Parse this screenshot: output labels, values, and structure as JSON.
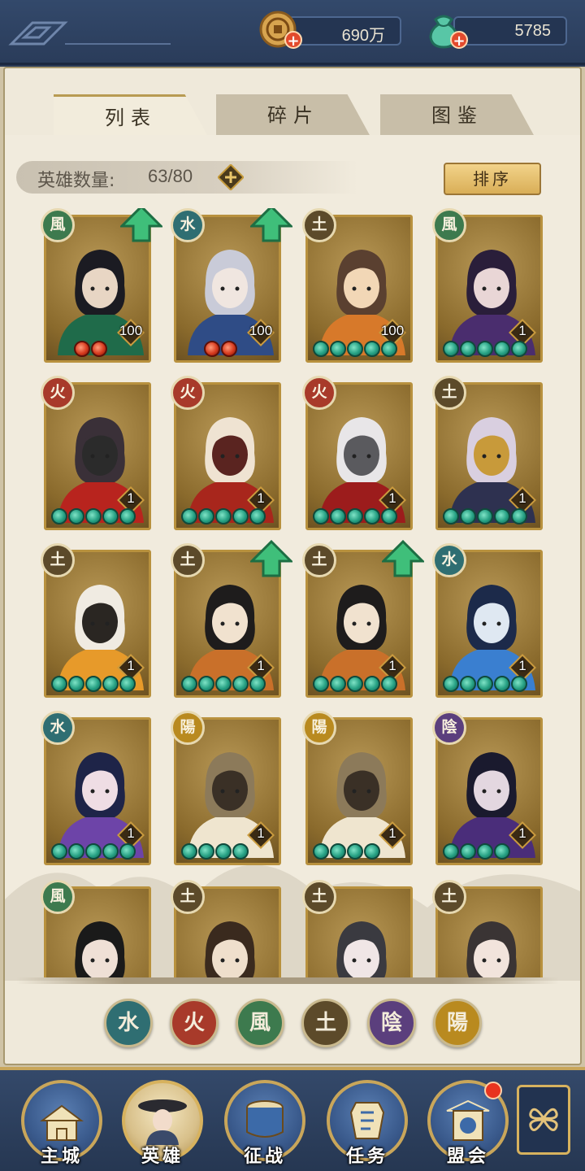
{
  "top_bar": {
    "coins": {
      "value": "690万",
      "icon": "coin-icon",
      "add_icon": "plus-icon"
    },
    "jade": {
      "value": "5785",
      "icon": "jade-pouch-icon",
      "add_icon": "plus-icon"
    }
  },
  "tabs": [
    {
      "label": "列表",
      "active": true
    },
    {
      "label": "碎片",
      "active": false
    },
    {
      "label": "图鉴",
      "active": false
    }
  ],
  "hero_count": {
    "label": "英雄数量:",
    "value": "63/80",
    "add_icon": "plus-icon"
  },
  "sort_button": {
    "label": "排序"
  },
  "colors": {
    "water": "#2f6e72",
    "fire": "#a83a2a",
    "wind": "#3d7a4e",
    "earth": "#5c4a2a",
    "yin": "#5b3f7d",
    "yang": "#b98a1f",
    "gem_green": "#26a083",
    "gem_red": "#d63a1e",
    "frame_gold": "#b8913e"
  },
  "heroes": [
    {
      "element": "風",
      "level": "100",
      "stars": 2,
      "star_color": "red",
      "upgrade": true,
      "palette": [
        "#1f6b4a",
        "#1b1b22",
        "#e8d6c4"
      ]
    },
    {
      "element": "水",
      "level": "100",
      "stars": 2,
      "star_color": "red",
      "upgrade": true,
      "palette": [
        "#2f4c86",
        "#c9cbd8",
        "#f0e6e0"
      ]
    },
    {
      "element": "土",
      "level": "100",
      "stars": 5,
      "star_color": "green",
      "upgrade": false,
      "palette": [
        "#d7792a",
        "#5a4030",
        "#f2d7b6"
      ]
    },
    {
      "element": "風",
      "level": "1",
      "stars": 5,
      "star_color": "green",
      "upgrade": false,
      "palette": [
        "#4a2d6e",
        "#2a1e3a",
        "#e9d6d6"
      ]
    },
    {
      "element": "火",
      "level": "1",
      "stars": 5,
      "star_color": "green",
      "upgrade": false,
      "palette": [
        "#b8241e",
        "#3a3038",
        "#2b2b2b"
      ]
    },
    {
      "element": "火",
      "level": "1",
      "stars": 5,
      "star_color": "green",
      "upgrade": false,
      "palette": [
        "#a8261c",
        "#efe3d2",
        "#5a2420"
      ]
    },
    {
      "element": "火",
      "level": "1",
      "stars": 5,
      "star_color": "green",
      "upgrade": false,
      "palette": [
        "#9c1c1c",
        "#e8e6e8",
        "#5a5a5e"
      ]
    },
    {
      "element": "土",
      "level": "1",
      "stars": 5,
      "star_color": "green",
      "upgrade": false,
      "palette": [
        "#2e3150",
        "#d9cfe0",
        "#c89a3a"
      ]
    },
    {
      "element": "土",
      "level": "1",
      "stars": 5,
      "star_color": "green",
      "upgrade": false,
      "palette": [
        "#e79a2a",
        "#f0ebe2",
        "#2a2622"
      ]
    },
    {
      "element": "土",
      "level": "1",
      "stars": 5,
      "star_color": "green",
      "upgrade": true,
      "palette": [
        "#c9702a",
        "#1e1c1c",
        "#f1e2cf"
      ]
    },
    {
      "element": "土",
      "level": "1",
      "stars": 5,
      "star_color": "green",
      "upgrade": true,
      "palette": [
        "#c9702a",
        "#1e1c1c",
        "#f1e2cf"
      ]
    },
    {
      "element": "水",
      "level": "1",
      "stars": 5,
      "star_color": "green",
      "upgrade": false,
      "palette": [
        "#3a7fd0",
        "#1c2a4a",
        "#dfe8f2"
      ]
    },
    {
      "element": "水",
      "level": "1",
      "stars": 5,
      "star_color": "green",
      "upgrade": false,
      "palette": [
        "#6d44a8",
        "#1e2448",
        "#efdde4"
      ]
    },
    {
      "element": "陽",
      "level": "1",
      "stars": 4,
      "star_color": "green",
      "upgrade": false,
      "palette": [
        "#efe5cf",
        "#8c7a5a",
        "#3a3026"
      ]
    },
    {
      "element": "陽",
      "level": "1",
      "stars": 4,
      "star_color": "green",
      "upgrade": false,
      "palette": [
        "#efe5cf",
        "#8c7a5a",
        "#3a3026"
      ]
    },
    {
      "element": "陰",
      "level": "1",
      "stars": 4,
      "star_color": "green",
      "upgrade": false,
      "palette": [
        "#4a2d7a",
        "#1a1a2e",
        "#e3d7e0"
      ]
    },
    {
      "element": "風",
      "level": "",
      "stars": 0,
      "star_color": "green",
      "upgrade": false,
      "palette": [
        "#2f4a2e",
        "#1a1a1a",
        "#efe0d6"
      ]
    },
    {
      "element": "土",
      "level": "",
      "stars": 0,
      "star_color": "green",
      "upgrade": false,
      "palette": [
        "#6a4a2a",
        "#3a2a1e",
        "#efdfcc"
      ]
    },
    {
      "element": "土",
      "level": "",
      "stars": 0,
      "star_color": "green",
      "upgrade": false,
      "palette": [
        "#8e8e94",
        "#3a3a40",
        "#f0e6e6"
      ]
    },
    {
      "element": "土",
      "level": "",
      "stars": 0,
      "star_color": "green",
      "upgrade": false,
      "palette": [
        "#9a8c80",
        "#3a3434",
        "#f2e4dc"
      ]
    }
  ],
  "element_filters": [
    {
      "glyph": "水",
      "name": "water"
    },
    {
      "glyph": "火",
      "name": "fire"
    },
    {
      "glyph": "風",
      "name": "wind"
    },
    {
      "glyph": "土",
      "name": "earth"
    },
    {
      "glyph": "陰",
      "name": "yin"
    },
    {
      "glyph": "陽",
      "name": "yang"
    }
  ],
  "bottom_nav": [
    {
      "label": "主城",
      "icon": "palace-icon",
      "active": false,
      "badge": false
    },
    {
      "label": "英雄",
      "icon": "hero-portrait-icon",
      "active": true,
      "badge": false
    },
    {
      "label": "征战",
      "icon": "war-drum-icon",
      "active": false,
      "badge": false
    },
    {
      "label": "任务",
      "icon": "scroll-bell-icon",
      "active": false,
      "badge": false
    },
    {
      "label": "盟会",
      "icon": "guild-gate-icon",
      "active": false,
      "badge": true
    }
  ],
  "more_button": {
    "icon": "clover-menu-icon"
  }
}
